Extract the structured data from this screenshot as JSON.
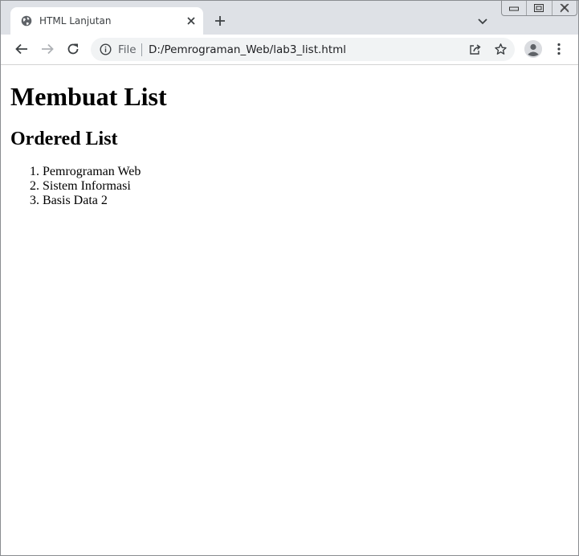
{
  "browser": {
    "tab": {
      "title": "HTML Lanjutan"
    },
    "omnibox": {
      "scheme_label": "File",
      "url": "D:/Pemrograman_Web/lab3_list.html"
    }
  },
  "page": {
    "heading": "Membuat List",
    "subheading": "Ordered List",
    "list_items": [
      "Pemrograman Web",
      "Sistem Informasi",
      "Basis Data 2"
    ]
  }
}
